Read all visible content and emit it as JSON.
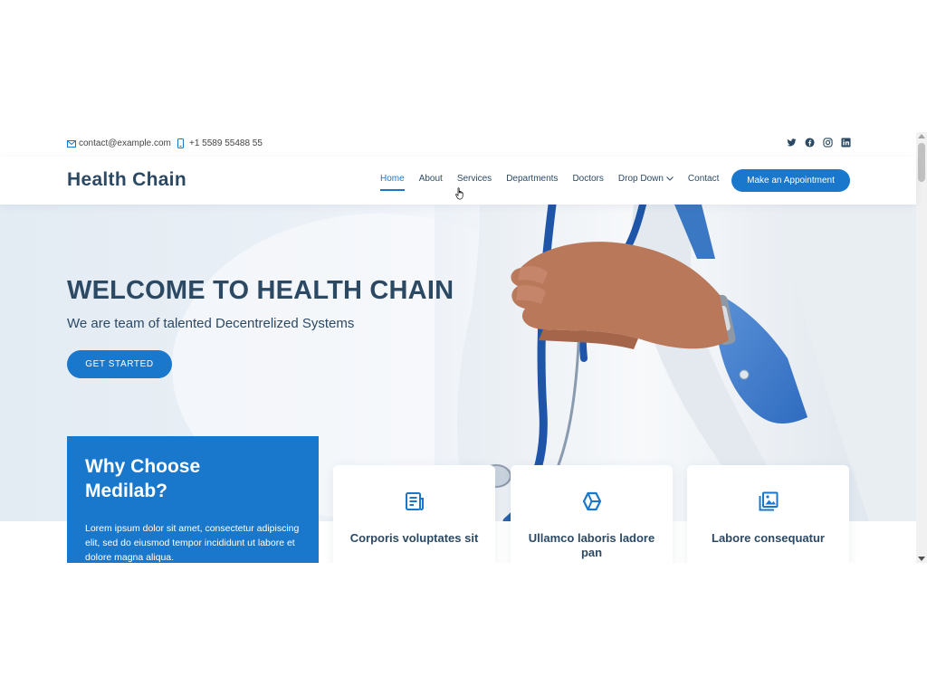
{
  "topbar": {
    "email": "contact@example.com",
    "phone": "+1 5589 55488 55",
    "socials": [
      "twitter-icon",
      "facebook-icon",
      "instagram-icon",
      "linkedin-icon"
    ]
  },
  "header": {
    "logo": "Health Chain",
    "nav": [
      {
        "label": "Home",
        "active": true
      },
      {
        "label": "About"
      },
      {
        "label": "Services"
      },
      {
        "label": "Departments"
      },
      {
        "label": "Doctors"
      },
      {
        "label": "Drop Down",
        "has_dropdown": true
      },
      {
        "label": "Contact"
      }
    ],
    "appointment_button": "Make an Appointment"
  },
  "hero": {
    "title": "WELCOME TO HEALTH CHAIN",
    "subtitle": "We are team of talented Decentrelized Systems",
    "cta": "GET STARTED"
  },
  "why": {
    "title": "Why Choose Medilab?",
    "text": "Lorem ipsum dolor sit amet, consectetur adipiscing elit, sed do eiusmod tempor incididunt ut labore et dolore magna aliqua."
  },
  "icon_boxes": [
    {
      "icon": "document-icon",
      "title": "Corporis voluptates sit"
    },
    {
      "icon": "cube-icon",
      "title": "Ullamco laboris ladore pan"
    },
    {
      "icon": "images-icon",
      "title": "Labore consequatur"
    }
  ],
  "colors": {
    "primary": "#1977cc",
    "heading": "#2c4964"
  }
}
